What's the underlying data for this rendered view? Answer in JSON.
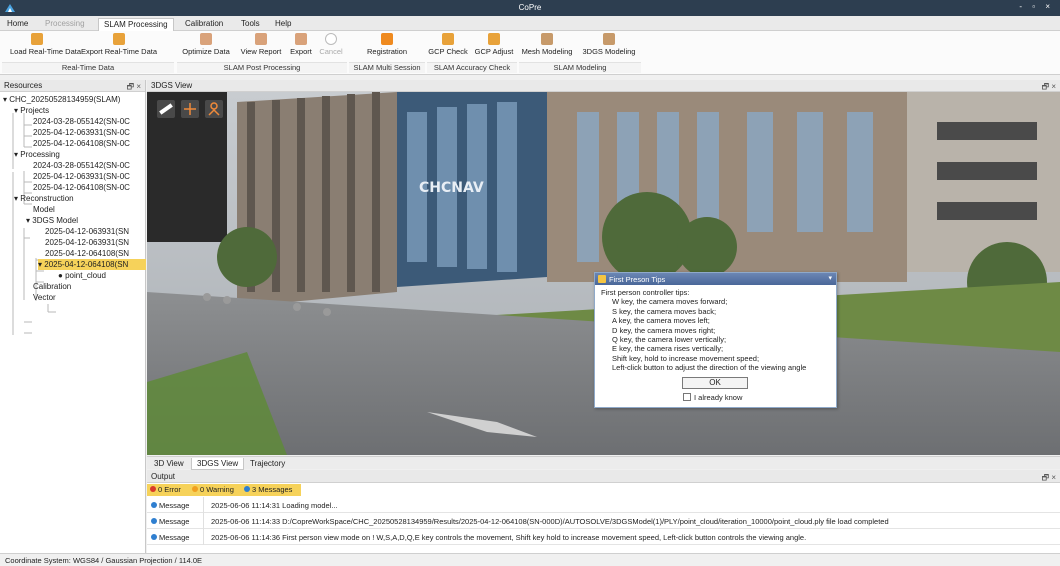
{
  "window": {
    "title": "CoPre",
    "controls": "- ▫ ×"
  },
  "menu_tabs": [
    "Home",
    "Processing",
    "SLAM Processing",
    "Calibration",
    "Tools",
    "Help"
  ],
  "ribbon": {
    "buttons": [
      "Load Real-Time Data",
      "Export Real-Time Data",
      "Optimize Data",
      "View Report",
      "Export",
      "Cancel",
      "Registration",
      "GCP Check",
      "GCP Adjust",
      "Mesh Modeling",
      "3DGS Modeling"
    ],
    "groups": [
      "Real-Time Data",
      "SLAM Post Processing",
      "SLAM Multi Session",
      "SLAM Accuracy Check",
      "SLAM Modeling"
    ]
  },
  "resources": {
    "title": "Resources",
    "controls": "🗗 ×",
    "tree": [
      "CHC_20250528134959(SLAM)",
      "Projects",
      "2024-03-28-055142(SN-0C",
      "2025-04-12-063931(SN-0C",
      "2025-04-12-064108(SN-0C",
      "Processing",
      "2024-03-28-055142(SN-0C",
      "2025-04-12-063931(SN-0C",
      "2025-04-12-064108(SN-0C",
      "Reconstruction",
      "Model",
      "3DGS Model",
      "2025-04-12-063931(SN",
      "2025-04-12-063931(SN",
      "2025-04-12-064108(SN",
      "2025-04-12-064108(SN",
      "point_cloud",
      "Calibration",
      "Vector"
    ]
  },
  "view": {
    "title": "3DGS View",
    "controls": "🗗 ×",
    "sign_text": "CHCNAV",
    "tabs": [
      "3D View",
      "3DGS View",
      "Trajectory"
    ]
  },
  "dialog": {
    "title": "First Preson Tips",
    "close": "▾",
    "heading": "First person controller tips:",
    "lines": [
      "W key, the camera moves forward;",
      "S key, the camera moves back;",
      "A key, the camera moves left;",
      "D key, the camera moves right;",
      "Q key, the camera lower vertically;",
      "E key, the camera rises vertically;",
      "Shift key, hold to increase movement speed;",
      "Left-click button to adjust the direction of the viewing angle"
    ],
    "ok_label": "OK",
    "know_label": "I already know"
  },
  "output": {
    "title": "Output",
    "controls": "🗗 ×",
    "filters": {
      "error": "0 Error",
      "warning": "0 Warning",
      "messages": "3 Messages"
    },
    "rows": [
      {
        "type": "Message",
        "text": "2025-06-06 11:14:31 Loading model..."
      },
      {
        "type": "Message",
        "text": "2025-06-06 11:14:33 D:/CopreWorkSpace/CHC_20250528134959/Results/2025-04-12-064108(SN-000D)/AUTOSOLVE/3DGSModel(1)/PLY/point_cloud/iteration_10000/point_cloud.ply file load completed"
      },
      {
        "type": "Message",
        "text": "2025-06-06 11:14:36 First person view mode on ! W,S,A,D,Q,E key controls the movement, Shift key hold to increase movement speed, Left-click button controls the viewing angle."
      }
    ]
  },
  "statusbar": {
    "text": "Coordinate System: WGS84 / Gaussian Projection / 114.0E"
  },
  "colors": {
    "titlebar": "#2d3e50",
    "selected": "#f6d25a",
    "info_dot": "#2f7fd0",
    "error_dot": "#d93a2b",
    "warning_dot": "#f0a020"
  }
}
